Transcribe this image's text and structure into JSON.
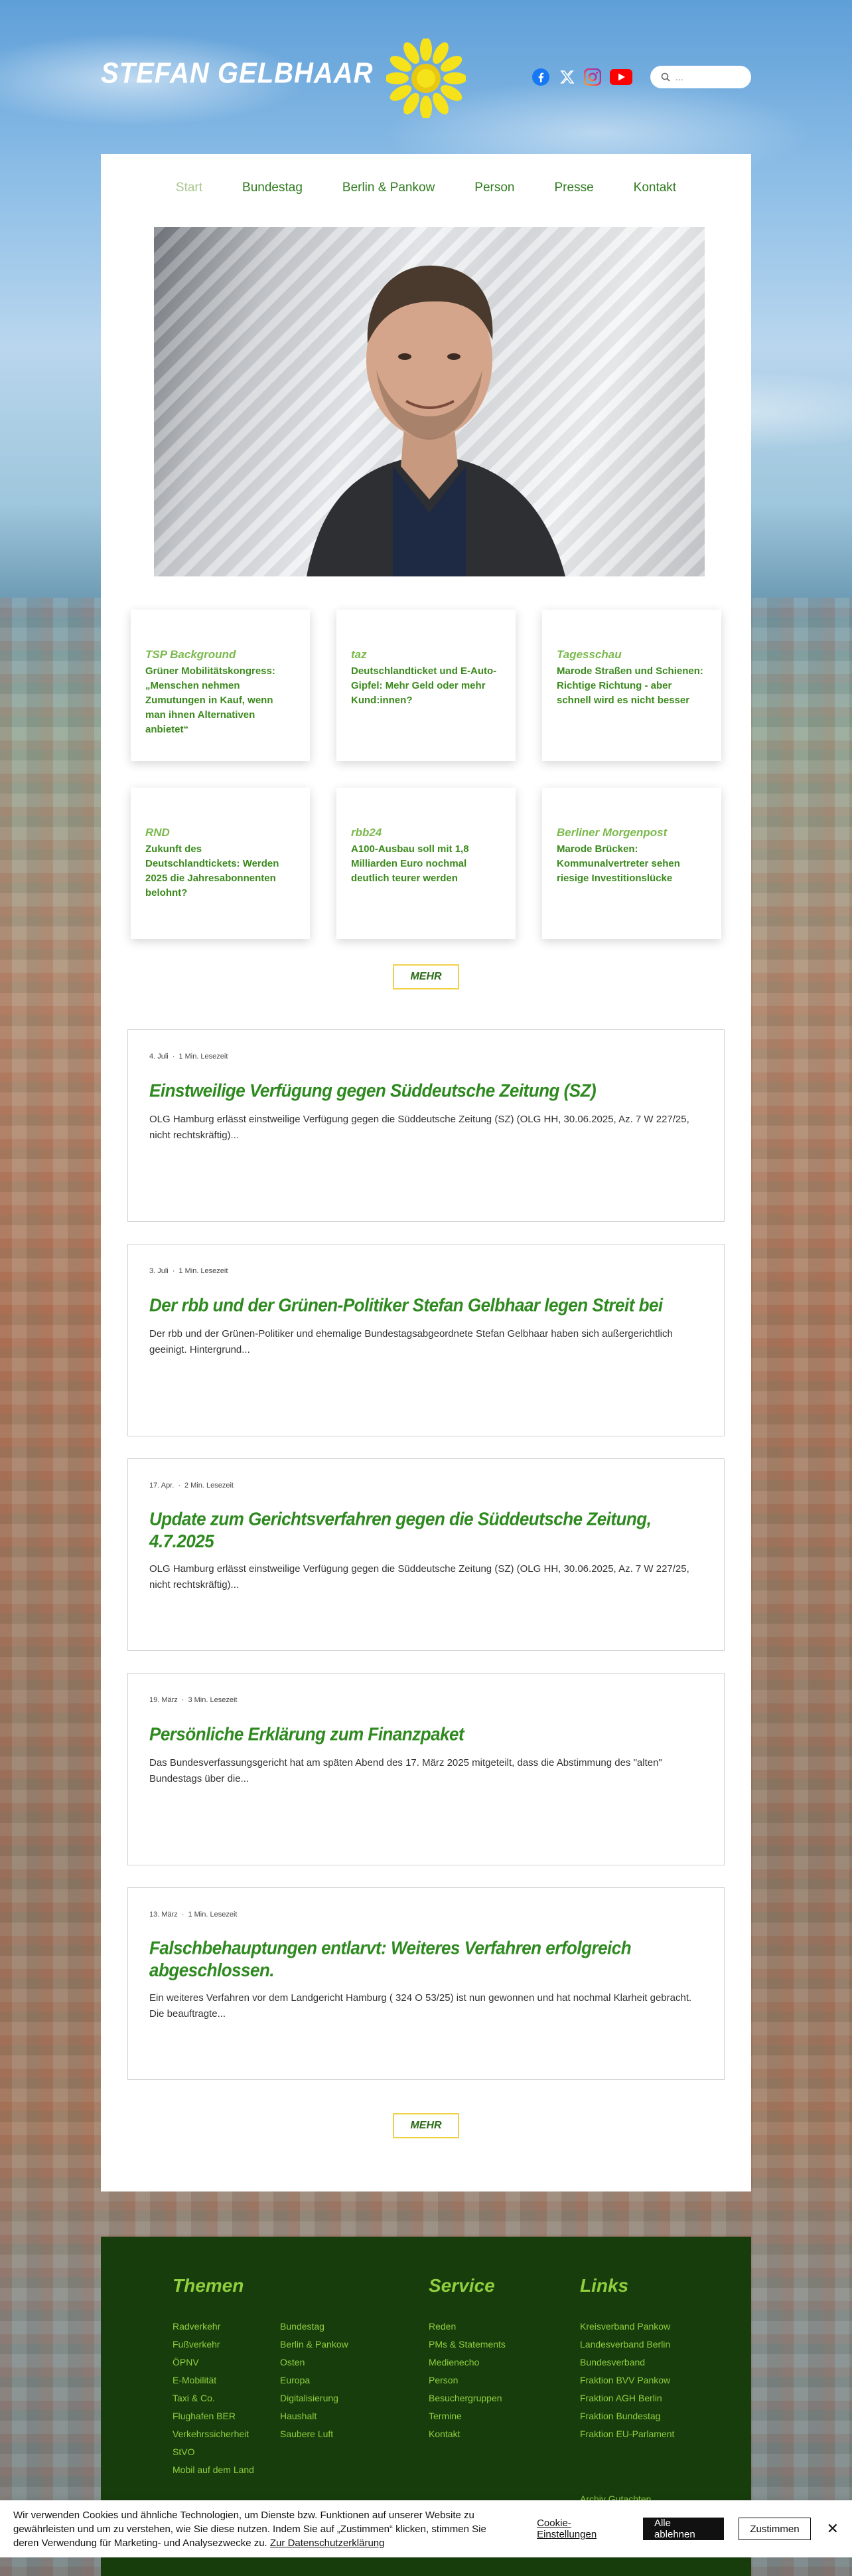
{
  "site": {
    "title": "STEFAN GELBHAAR"
  },
  "search": {
    "placeholder": "..."
  },
  "social": [
    "facebook-icon",
    "x-icon",
    "instagram-icon",
    "youtube-icon"
  ],
  "nav": [
    {
      "label": "Start",
      "active": true
    },
    {
      "label": "Bundestag"
    },
    {
      "label": "Berlin & Pankow"
    },
    {
      "label": "Person"
    },
    {
      "label": "Presse"
    },
    {
      "label": "Kontakt"
    }
  ],
  "press": [
    {
      "source": "TSP Background",
      "headline": "Grüner Mobilitätskongress: „Menschen nehmen Zumutungen in Kauf, wenn man ihnen Alternativen anbietet“"
    },
    {
      "source": "taz",
      "headline": "Deutschlandticket und E-Auto-Gipfel: Mehr Geld oder mehr Kund:innen?"
    },
    {
      "source": "Tagesschau",
      "headline": "Marode Straßen und Schienen: Richtige Richtung - aber schnell wird es nicht besser"
    },
    {
      "source": "RND",
      "headline": "Zukunft des Deutschlandtickets: Werden 2025 die Jahresabonnenten belohnt?"
    },
    {
      "source": "rbb24",
      "headline": "A100-Ausbau soll mit 1,8 Milliarden Euro nochmal deutlich teurer werden"
    },
    {
      "source": "Berliner Morgenpost",
      "headline": "Marode Brücken: Kommunalvertreter sehen riesige Investitionslücke"
    }
  ],
  "more_label": "MEHR",
  "posts": [
    {
      "date": "4. Juli",
      "read": "1 Min. Lesezeit",
      "title": "Einstweilige Verfügung gegen Süddeutsche Zeitung (SZ)",
      "excerpt": "OLG Hamburg erlässt einstweilige Verfügung gegen die Süddeutsche Zeitung (SZ) (OLG HH, 30.06.2025, Az. 7 W 227/25, nicht rechtskräftig)..."
    },
    {
      "date": "3. Juli",
      "read": "1 Min. Lesezeit",
      "title": "Der rbb und der Grünen-Politiker Stefan Gelbhaar legen Streit bei",
      "excerpt": "Der rbb und der Grünen-Politiker und ehemalige Bundestagsabgeordnete Stefan Gelbhaar haben sich außergerichtlich geeinigt. Hintergrund..."
    },
    {
      "date": "17. Apr.",
      "read": "2 Min. Lesezeit",
      "title": "Update zum Gerichtsverfahren gegen die Süddeutsche Zeitung, 4.7.2025",
      "excerpt": "OLG Hamburg erlässt einstweilige Verfügung gegen die Süddeutsche Zeitung (SZ) (OLG HH, 30.06.2025, Az. 7 W 227/25, nicht rechtskräftig)..."
    },
    {
      "date": "19. März",
      "read": "3 Min. Lesezeit",
      "title": "Persönliche Erklärung zum Finanzpaket",
      "excerpt": "Das Bundesverfassungsgericht hat am späten Abend des 17. März 2025 mitgeteilt, dass die Abstimmung des \"alten\" Bundestags über die..."
    },
    {
      "date": "13. März",
      "read": "1 Min. Lesezeit",
      "title": "Falschbehauptungen entlarvt: Weiteres Verfahren erfolgreich abgeschlossen.",
      "excerpt": "Ein weiteres Verfahren vor dem Landgericht Hamburg ( 324 O 53/25) ist nun gewonnen und hat nochmal Klarheit gebracht. Die beauftragte..."
    }
  ],
  "footer": {
    "themen_heading": "Themen",
    "themen_col1": [
      "Radverkehr",
      "Fußverkehr",
      "ÖPNV",
      "E-Mobilität",
      "Taxi & Co.",
      "Flughafen BER",
      "Verkehrssicherheit",
      "StVO",
      "Mobil auf dem Land"
    ],
    "themen_col2": [
      "Bundestag",
      "Berlin & Pankow",
      "Osten",
      "Europa",
      "Digitalisierung",
      "Haushalt",
      "Saubere Luft"
    ],
    "service_heading": "Service",
    "service": [
      "Reden",
      "PMs & Statements",
      "Medienecho",
      "Person",
      "Besuchergruppen",
      "Termine",
      "Kontakt"
    ],
    "links_heading": "Links",
    "links": [
      "Kreisverband Pankow",
      "Landesverband Berlin",
      "Bundesverband",
      "Fraktion BVV Pankow",
      "Fraktion AGH Berlin",
      "Fraktion Bundestag",
      "Fraktion EU-Parlament"
    ],
    "extra": "Archiv Gutachten"
  },
  "cookie": {
    "text": "Wir verwenden Cookies und ähnliche Technologien, um Dienste bzw. Funktionen auf unserer Website zu gewährleisten und um zu verstehen, wie Sie diese nutzen. Indem Sie auf „Zustimmen“ klicken, stimmen Sie deren Verwendung für Marketing- und Analysezwecke zu.",
    "privacy_link": "Zur Datenschutzerklärung",
    "settings": "Cookie-Einstellungen",
    "decline": "Alle ablehnen",
    "accept": "Zustimmen"
  },
  "colors": {
    "primary_green": "#2f7a1e",
    "light_green": "#8fcf3e",
    "footer_bg": "#173d0c",
    "sun_yellow": "#f6e21a"
  }
}
